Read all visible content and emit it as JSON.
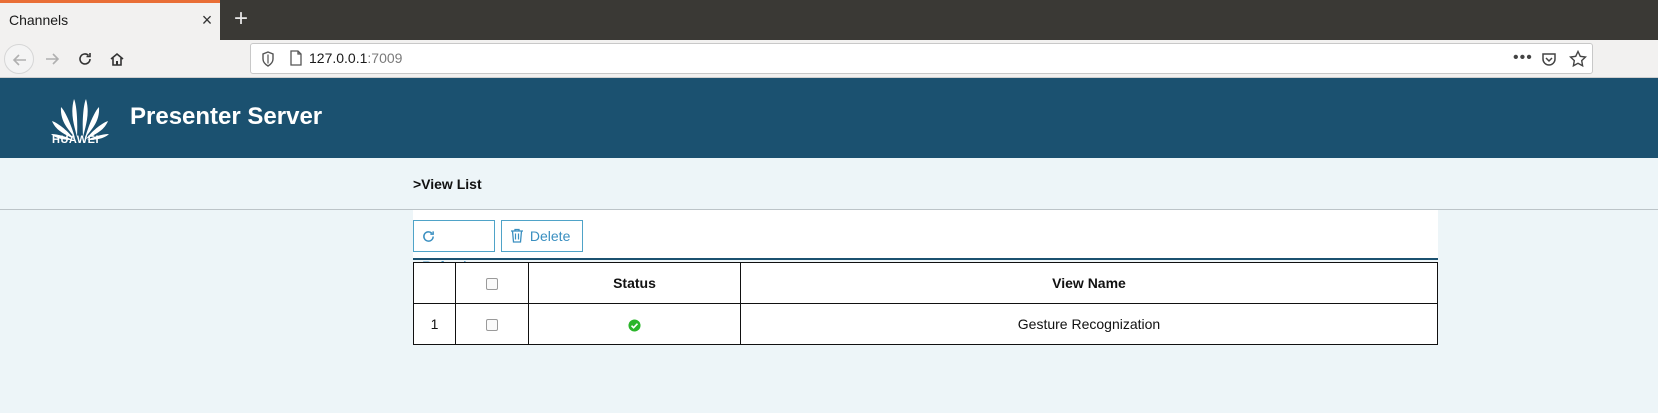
{
  "browser": {
    "tab_title": "Channels",
    "url_host": "127.0.0.1",
    "url_port": ":7009",
    "url_more": "•••"
  },
  "header": {
    "logo_text": "HUAWEI",
    "title": "Presenter Server",
    "brand_color": "#1b5170"
  },
  "breadcrumb": ">View List",
  "toolbar": {
    "refresh_label": "Refresh",
    "delete_label": "Delete"
  },
  "table": {
    "headers": {
      "status": "Status",
      "view_name": "View Name"
    },
    "rows": [
      {
        "index": "1",
        "status": "ok",
        "view_name": "Gesture Recognization"
      }
    ]
  }
}
